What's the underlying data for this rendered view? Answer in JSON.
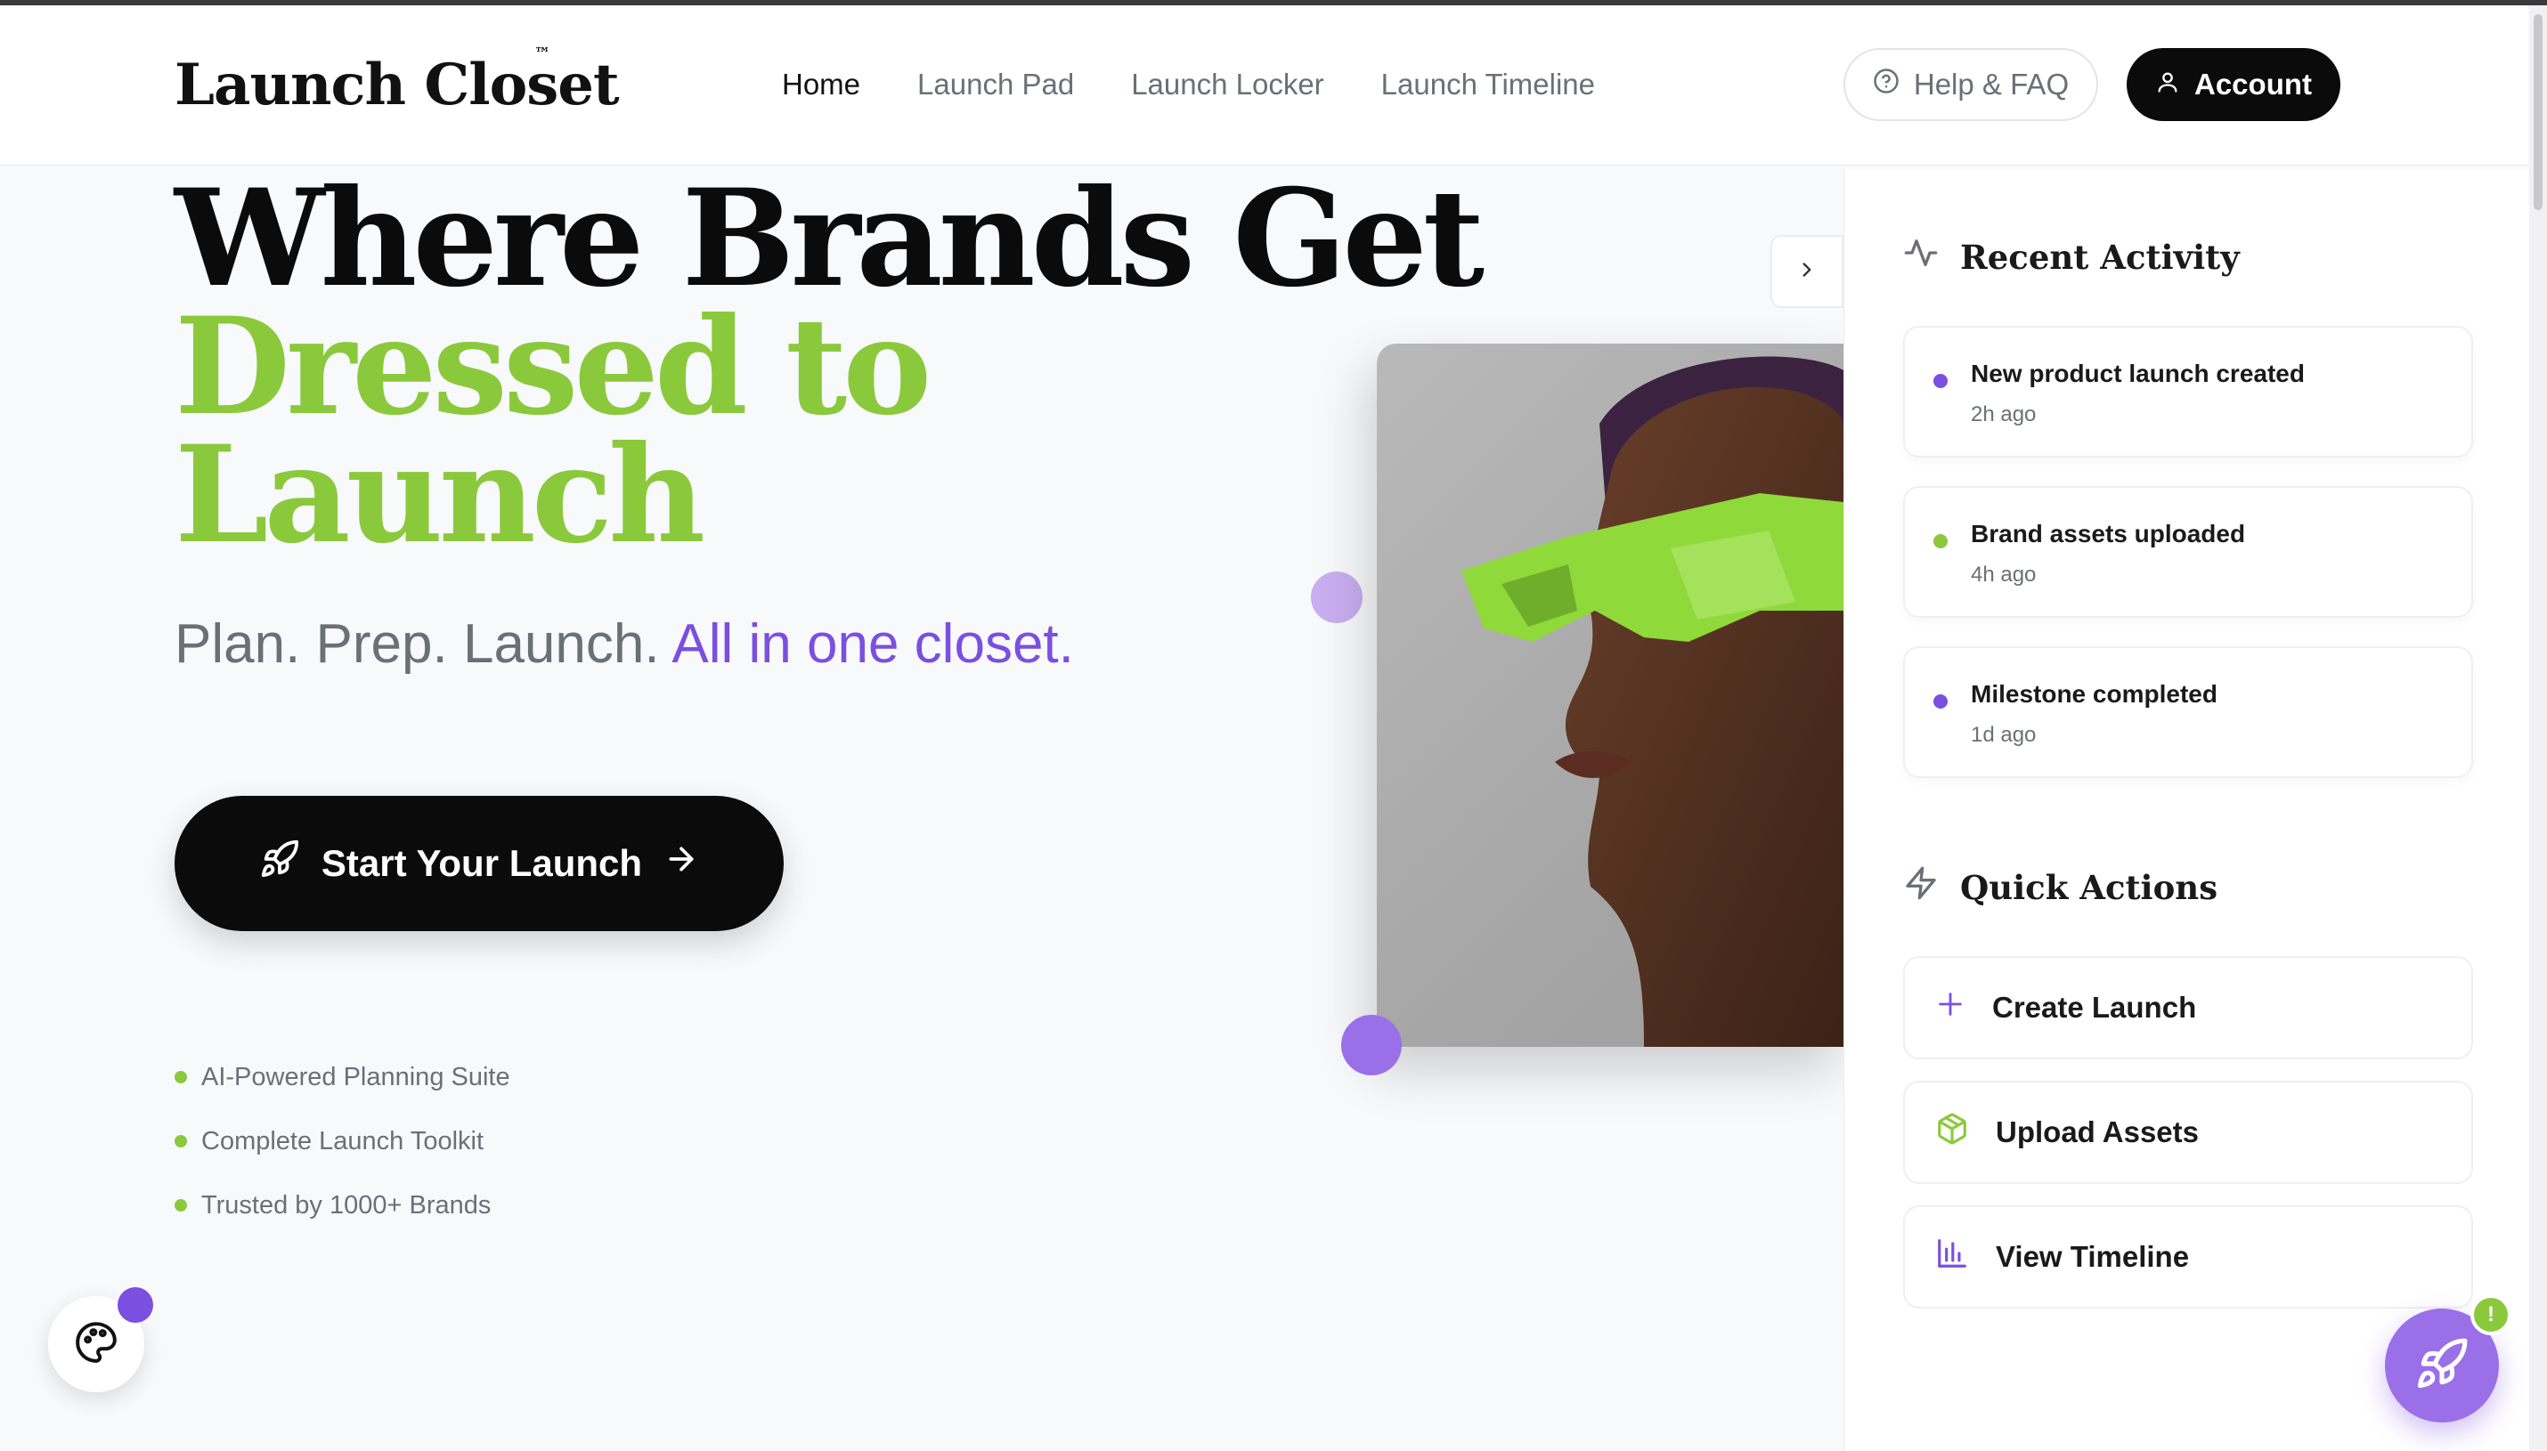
{
  "brand": {
    "name": "Launch Closet",
    "trademark": "™"
  },
  "nav": {
    "items": [
      {
        "label": "Home",
        "active": true
      },
      {
        "label": "Launch Pad",
        "active": false
      },
      {
        "label": "Launch Locker",
        "active": false
      },
      {
        "label": "Launch Timeline",
        "active": false
      }
    ]
  },
  "header": {
    "help_label": "Help & FAQ",
    "account_label": "Account"
  },
  "hero": {
    "title_line1": "Where Brands Get",
    "title_line2": "Dressed to",
    "title_line3": "Launch",
    "tagline_plain": "Plan. Prep. Launch. ",
    "tagline_accent": "All in one closet.",
    "cta_label": "Start Your Launch",
    "features": [
      "AI-Powered Planning Suite",
      "Complete Launch Toolkit",
      "Trusted by 1000+ Brands"
    ]
  },
  "panel": {
    "recent_heading": "Recent Activity",
    "activities": [
      {
        "title": "New product launch created",
        "time": "2h ago",
        "dot_color": "#7b4fe0"
      },
      {
        "title": "Brand assets uploaded",
        "time": "4h ago",
        "dot_color": "#8bc93c"
      },
      {
        "title": "Milestone completed",
        "time": "1d ago",
        "dot_color": "#7b4fe0"
      }
    ],
    "quick_heading": "Quick Actions",
    "actions": [
      {
        "label": "Create Launch",
        "icon": "plus-icon"
      },
      {
        "label": "Upload Assets",
        "icon": "box-icon"
      },
      {
        "label": "View Timeline",
        "icon": "bar-chart-icon"
      }
    ]
  },
  "fab": {
    "badge": "!"
  },
  "colors": {
    "accent_green": "#8bc93c",
    "accent_purple": "#7b4fe0",
    "dark": "#0b0b0c",
    "muted_text": "#6b6f76"
  }
}
